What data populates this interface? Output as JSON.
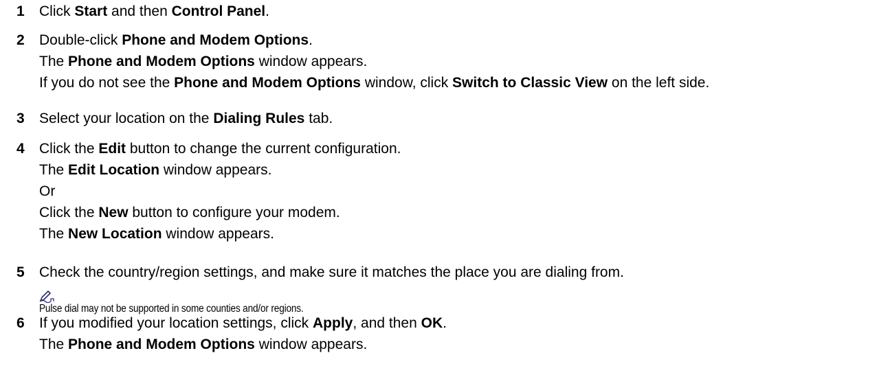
{
  "steps": [
    {
      "number": "1",
      "lines": [
        [
          [
            "t",
            "Click "
          ],
          [
            "b",
            "Start"
          ],
          [
            "t",
            " and then "
          ],
          [
            "b",
            "Control Panel"
          ],
          [
            "t",
            "."
          ]
        ]
      ]
    },
    {
      "number": "2",
      "lines": [
        [
          [
            "t",
            "Double-click "
          ],
          [
            "b",
            "Phone and Modem Options"
          ],
          [
            "t",
            "."
          ]
        ],
        [
          [
            "t",
            "The "
          ],
          [
            "b",
            "Phone and Modem Options"
          ],
          [
            "t",
            " window appears."
          ]
        ],
        [
          [
            "t",
            "If you do not see the "
          ],
          [
            "b",
            "Phone and Modem Options"
          ],
          [
            "t",
            " window, click "
          ],
          [
            "b",
            "Switch to Classic View"
          ],
          [
            "t",
            " on the left side."
          ]
        ]
      ]
    },
    {
      "number": "3",
      "lines": [
        [
          [
            "t",
            "Select your location on the "
          ],
          [
            "b",
            "Dialing Rules"
          ],
          [
            "t",
            " tab."
          ]
        ]
      ]
    },
    {
      "number": "4",
      "lines": [
        [
          [
            "t",
            "Click the "
          ],
          [
            "b",
            "Edit"
          ],
          [
            "t",
            " button to change the current configuration."
          ]
        ],
        [
          [
            "t",
            "The "
          ],
          [
            "b",
            "Edit Location"
          ],
          [
            "t",
            " window appears."
          ]
        ],
        [
          [
            "t",
            "Or"
          ]
        ],
        [
          [
            "t",
            "Click the "
          ],
          [
            "b",
            "New"
          ],
          [
            "t",
            " button to configure your modem."
          ]
        ],
        [
          [
            "t",
            "The "
          ],
          [
            "b",
            "New Location"
          ],
          [
            "t",
            " window appears."
          ]
        ]
      ]
    },
    {
      "number": "5",
      "lines": [
        [
          [
            "t",
            "Check the country/region settings, and make sure it matches the place you are dialing from."
          ]
        ]
      ]
    },
    {
      "number": "6",
      "lines": [
        [
          [
            "t",
            "If you modified your location settings, click "
          ],
          [
            "b",
            "Apply"
          ],
          [
            "t",
            ", and then "
          ],
          [
            "b",
            "OK"
          ],
          [
            "t",
            "."
          ]
        ],
        [
          [
            "t",
            "The "
          ],
          [
            "b",
            "Phone and Modem Options"
          ],
          [
            "t",
            " window appears."
          ]
        ]
      ]
    }
  ],
  "note": {
    "icon": "note-pencil-icon",
    "text": "Pulse dial may not be supported in some counties and/or regions."
  }
}
